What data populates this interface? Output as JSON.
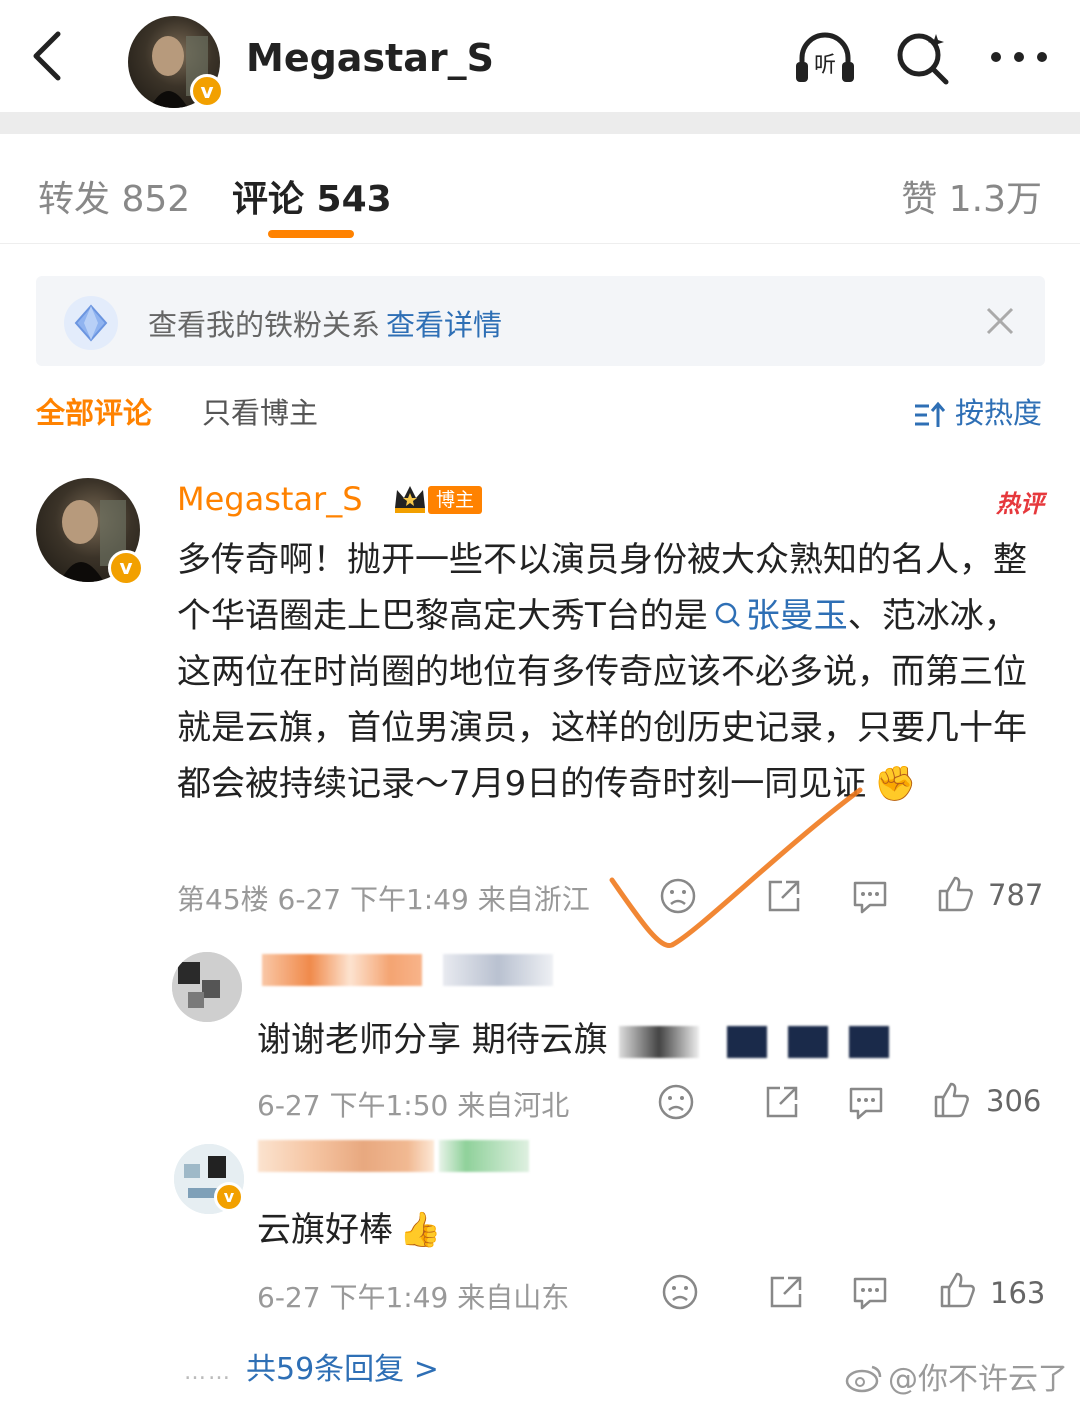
{
  "header": {
    "username": "Megastar_S",
    "verify_badge": "v",
    "icons": [
      "back-icon",
      "listen-icon",
      "search-icon",
      "more-icon"
    ],
    "listen_label": "听"
  },
  "tabs": {
    "repost": "转发 852",
    "comment": "评论 543",
    "like": "赞 1.3万"
  },
  "banner": {
    "text": "查看我的铁粉关系",
    "link": "查看详情"
  },
  "filter": {
    "all": "全部评论",
    "host_only": "只看博主",
    "sort": "按热度"
  },
  "comment": {
    "username": "Megastar_S",
    "host_tag": "博主",
    "hot_tag": "热评",
    "text_before_link": "多传奇啊！抛开一些不以演员身份被大众熟知的名人，整个华语圈走上巴黎高定大秀T台的是",
    "link_text": "张曼玉",
    "text_after_link": "、范冰冰，这两位在时尚圈的地位有多传奇应该不必多说，而第三位就是云旗，首位男演员，这样的创历史记录，只要几十年都会被持续记录～7月9日的传奇时刻一同见证",
    "emoji": "✊",
    "meta": "第45楼 6-27 下午1:49 来自浙江",
    "likes": "787"
  },
  "replies": [
    {
      "text": "谢谢老师分享 期待云旗",
      "meta": "6-27 下午1:50 来自河北",
      "likes": "306"
    },
    {
      "text": "云旗好棒",
      "emoji": "👍",
      "meta": "6-27 下午1:49 来自山东",
      "likes": "163"
    }
  ],
  "more_replies": "共59条回复 >",
  "more_dots": "……",
  "watermark": "@你不许云了",
  "colors": {
    "accent": "#ff8200",
    "link": "#2e6fb5",
    "hot": "#e6383c"
  }
}
